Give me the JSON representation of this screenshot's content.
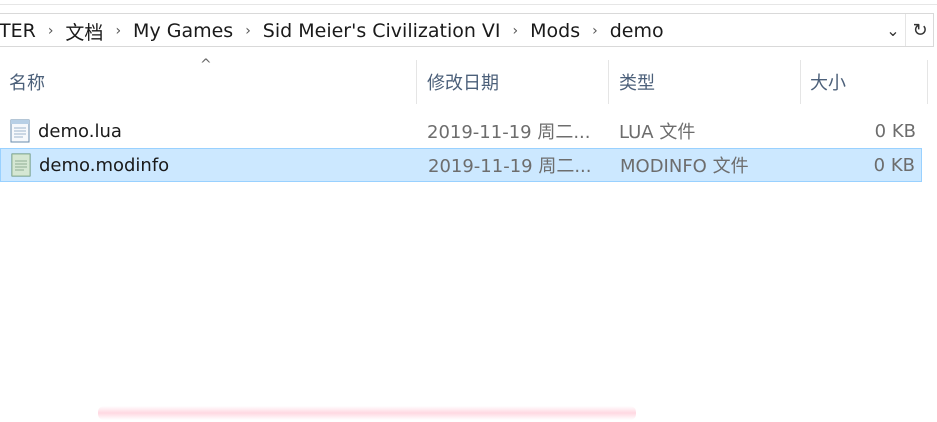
{
  "breadcrumb": {
    "items": [
      "TER",
      "文档",
      "My Games",
      "Sid Meier's Civilization VI",
      "Mods",
      "demo"
    ],
    "separator": "›"
  },
  "address_controls": {
    "dropdown_icon": "chevron-down-icon",
    "refresh_icon": "refresh-icon",
    "dropdown_glyph": "⌄",
    "refresh_glyph": "↻"
  },
  "columns": {
    "name": "名称",
    "modified": "修改日期",
    "type": "类型",
    "size": "大小",
    "sort_glyph": "^"
  },
  "files": [
    {
      "name": "demo.lua",
      "modified": "2019-11-19 周二...",
      "type": "LUA 文件",
      "size": "0 KB",
      "selected": false
    },
    {
      "name": "demo.modinfo",
      "modified": "2019-11-19 周二...",
      "type": "MODINFO 文件",
      "size": "0 KB",
      "selected": true
    }
  ],
  "colors": {
    "selection_bg": "#cce8ff",
    "selection_border": "#99d1ff",
    "header_text": "#4c607a",
    "secondary_text": "#6d6d6d"
  }
}
